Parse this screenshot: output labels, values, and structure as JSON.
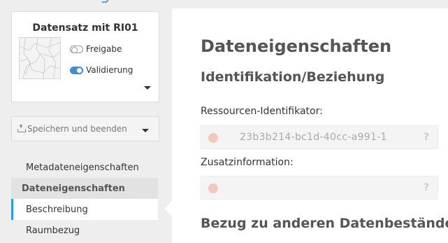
{
  "dataset": {
    "title": "Datensatz mit RI01",
    "toggles": [
      {
        "label": "Freigabe",
        "state": "off"
      },
      {
        "label": "Validierung",
        "state": "on"
      }
    ]
  },
  "save": {
    "label": "Speichern und beenden",
    "icon": "save-icon"
  },
  "nav": {
    "items": [
      {
        "label": "Metadateneigenschaften",
        "type": "child"
      },
      {
        "label": "Dateneigenschaften",
        "type": "section"
      },
      {
        "label": "Beschreibung",
        "type": "active"
      },
      {
        "label": "Raumbezug",
        "type": "child"
      }
    ]
  },
  "main": {
    "title": "Dateneigenschaften",
    "section1": "Identifikation/Beziehung",
    "fields": [
      {
        "label": "Ressourcen-Identifikator:",
        "value": "23b3b214-bc1d-40cc-a991-1",
        "help": "?"
      },
      {
        "label": "Zusatzinformation:",
        "value": "",
        "help": "?"
      }
    ],
    "section2": "Bezug zu anderen Datenbeständen"
  },
  "colors": {
    "accent": "#2a9fd6",
    "toggle_on": "#3a8fd6",
    "required_dot": "#f3c9bd",
    "background": "#eeeeee"
  }
}
